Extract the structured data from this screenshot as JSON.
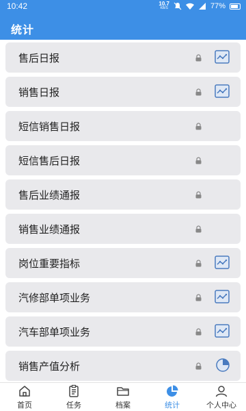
{
  "status_bar": {
    "time": "10:42",
    "speed_value": "10.7",
    "speed_unit": "KB/S",
    "battery": "77%"
  },
  "header": {
    "title": "统计"
  },
  "items": [
    {
      "label": "售后日报",
      "icon": "line-chart-icon"
    },
    {
      "label": "销售日报",
      "icon": "line-chart-icon"
    },
    {
      "label": "短信销售日报",
      "icon": ""
    },
    {
      "label": "短信售后日报",
      "icon": ""
    },
    {
      "label": "售后业绩通报",
      "icon": ""
    },
    {
      "label": "销售业绩通报",
      "icon": ""
    },
    {
      "label": "岗位重要指标",
      "icon": "line-chart-icon"
    },
    {
      "label": "汽修部单项业务",
      "icon": "line-chart-icon"
    },
    {
      "label": "汽车部单项业务",
      "icon": "line-chart-icon"
    },
    {
      "label": "销售产值分析",
      "icon": "pie-chart-icon"
    }
  ],
  "nav": [
    {
      "label": "首页",
      "icon": "home-icon"
    },
    {
      "label": "任务",
      "icon": "clipboard-icon"
    },
    {
      "label": "档案",
      "icon": "folder-icon"
    },
    {
      "label": "统计",
      "icon": "pie-chart-icon",
      "active": true
    },
    {
      "label": "个人中心",
      "icon": "user-icon"
    }
  ],
  "colors": {
    "accent": "#3d8fe6",
    "item_background": "#e9e9ec"
  }
}
